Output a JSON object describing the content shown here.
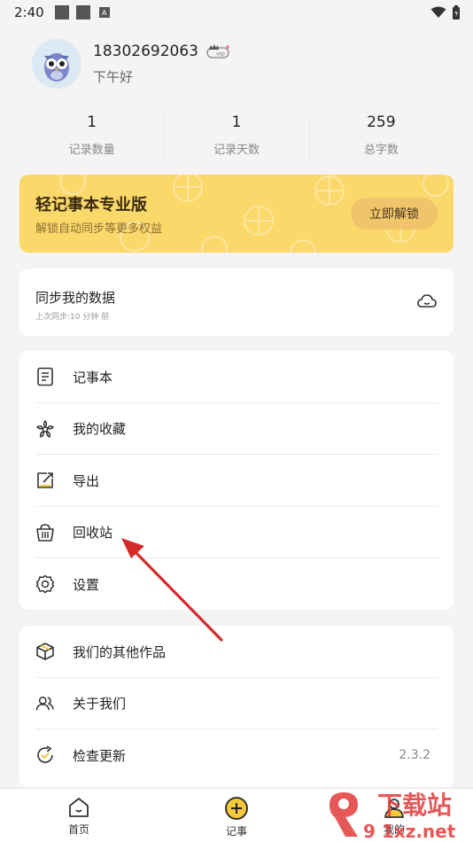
{
  "status_bar": {
    "time": "2:40",
    "a_glyph": "A"
  },
  "profile": {
    "phone": "18302692063",
    "vip_badge": "vip",
    "greeting": "下午好"
  },
  "stats": [
    {
      "value": "1",
      "label": "记录数量"
    },
    {
      "value": "1",
      "label": "记录天数"
    },
    {
      "value": "259",
      "label": "总字数"
    }
  ],
  "pro_card": {
    "title": "轻记事本专业版",
    "subtitle": "解锁自动同步等更多权益",
    "button": "立即解锁"
  },
  "sync_card": {
    "title": "同步我的数据",
    "subtitle": "上次同步:10 分钟 前"
  },
  "menu_primary": [
    {
      "label": "记事本",
      "icon": "notebook-icon"
    },
    {
      "label": "我的收藏",
      "icon": "flower-icon"
    },
    {
      "label": "导出",
      "icon": "export-icon"
    },
    {
      "label": "回收站",
      "icon": "trash-basket-icon"
    },
    {
      "label": "设置",
      "icon": "gear-icon"
    }
  ],
  "menu_secondary": [
    {
      "label": "我们的其他作品",
      "icon": "cube-icon"
    },
    {
      "label": "关于我们",
      "icon": "people-icon"
    },
    {
      "label": "检查更新",
      "icon": "refresh-icon",
      "value": "2.3.2"
    }
  ],
  "bottom_nav": [
    {
      "label": "首页",
      "icon": "home-icon"
    },
    {
      "label": "记事",
      "icon": "plus-circle-icon"
    },
    {
      "label": "我的",
      "icon": "person-icon"
    }
  ],
  "watermark": {
    "text_top": "下载站",
    "text_bottom": "9 1xz.net"
  },
  "colors": {
    "accent": "#f5c83c",
    "pro_card": "#fbd86a",
    "arrow": "#d42a2a",
    "background": "#f4f4f4"
  }
}
